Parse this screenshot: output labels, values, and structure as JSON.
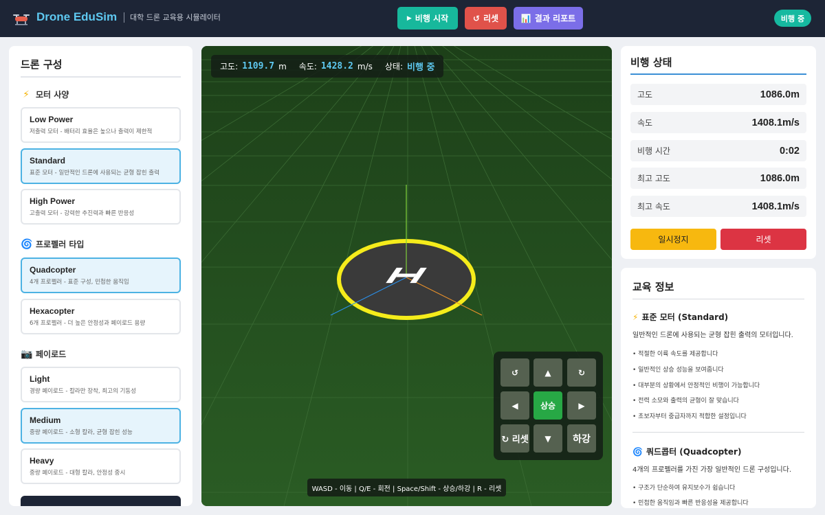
{
  "header": {
    "app_name": "Drone EduSim",
    "subtitle": "대학 드론 교육용 시뮬레이터",
    "start_label": "비행 시작",
    "start_icon": "▶",
    "reset_label": "리셋",
    "reset_icon": "↺",
    "report_label": "결과 리포트",
    "report_icon": "📊",
    "status": "비행 중"
  },
  "config": {
    "title": "드론 구성",
    "motor": {
      "heading": "모터 사양",
      "icon": "⚡",
      "options": [
        {
          "name": "Low Power",
          "desc": "저출력 모터 - 배터리 효율은 높으나 출력이 제한적"
        },
        {
          "name": "Standard",
          "desc": "표준 모터 - 일반적인 드론에 사용되는 균형 잡힌 출력"
        },
        {
          "name": "High Power",
          "desc": "고출력 모터 - 강력한 추진력과 빠른 반응성"
        }
      ]
    },
    "propeller": {
      "heading": "프로펠러 타입",
      "icon": "🌀",
      "options": [
        {
          "name": "Quadcopter",
          "desc": "4개 프로펠러 - 표준 구성, 민첩한 움직임"
        },
        {
          "name": "Hexacopter",
          "desc": "6개 프로펠러 - 더 높은 안정성과 페이로드 용량"
        }
      ]
    },
    "payload": {
      "heading": "페이로드",
      "icon": "📷",
      "options": [
        {
          "name": "Light",
          "desc": "경량 페이로드 - 칼라만 장착, 최고의 기동성"
        },
        {
          "name": "Medium",
          "desc": "중량 페이로드 - 소형 칼라, 균형 잡힌 성능"
        },
        {
          "name": "Heavy",
          "desc": "중량 페이로드 - 대형 칼라, 안정성 중시"
        }
      ]
    }
  },
  "hud": {
    "alt_label": "고도:",
    "alt_value": "1109.7",
    "alt_unit": "m",
    "speed_label": "속도:",
    "speed_value": "1428.2",
    "speed_unit": "m/s",
    "state_label": "상태:",
    "state_value": "비행 중"
  },
  "controls": {
    "rot_left": "↺",
    "up": "▲",
    "rot_right": "↻",
    "left": "◀",
    "ascend": "상승",
    "right": "▶",
    "reset": "↻ 리셋",
    "down": "▼",
    "descend": "하강"
  },
  "key_hint": "WASD - 이동 | Q/E - 회전 | Space/Shift - 상승/하강 | R - 리셋",
  "flight_status": {
    "title": "비행 상태",
    "stats": [
      {
        "label": "고도",
        "value": "1086.0m"
      },
      {
        "label": "속도",
        "value": "1408.1m/s"
      },
      {
        "label": "비행 시간",
        "value": "0:02"
      },
      {
        "label": "최고 고도",
        "value": "1086.0m"
      },
      {
        "label": "최고 속도",
        "value": "1408.1m/s"
      }
    ],
    "pause_label": "일시정지",
    "reset_label": "리셋"
  },
  "edu_info": {
    "title": "교육 정보",
    "motor_icon": "⚡",
    "motor_heading": "표준 모터 (Standard)",
    "motor_desc": "일반적인 드론에 사용되는 균형 잡힌 출력의 모터입니다.",
    "motor_points": [
      "• 적절한 이륙 속도를 제공합니다",
      "• 일반적인 상승 성능을 보여줍니다",
      "• 대부분의 상황에서 안정적인 비행이 가능합니다",
      "• 전력 소모와 출력의 균형이 잘 맞습니다",
      "• 초보자부터 중급자까지 적합한 설정입니다"
    ],
    "prop_icon": "🌀",
    "prop_heading": "쿼드콥터 (Quadcopter)",
    "prop_desc": "4개의 프로펠러를 가진 가장 일반적인 드론 구성입니다.",
    "prop_points": [
      "• 구조가 단순하여 유지보수가 쉽습니다",
      "• 민첩한 움직임과 빠른 반응성을 제공합니다"
    ]
  },
  "colors": {
    "header_bg": "#1d2536",
    "accent_cyan": "#5ec8f0",
    "ground": "#23501f",
    "helipad_ring": "#f5ec1b",
    "selected_border": "#4cb2e3"
  }
}
